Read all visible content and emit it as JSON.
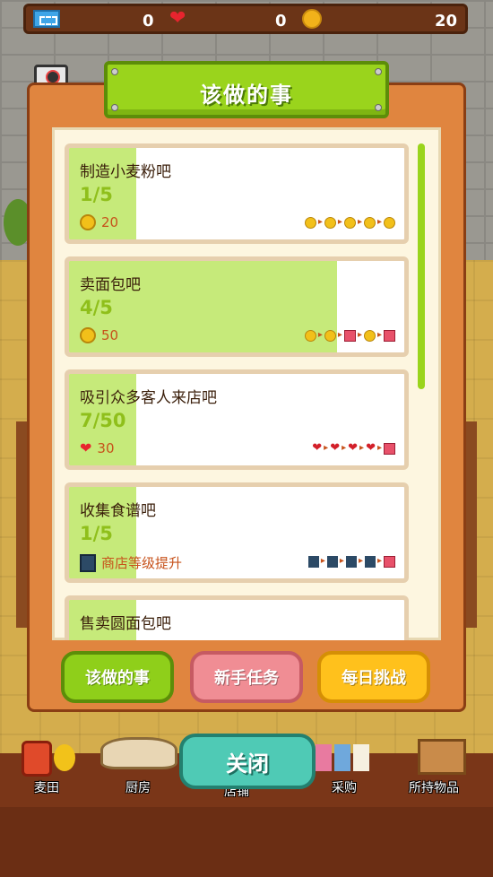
{
  "resources": {
    "tickets": "0",
    "hearts": "0",
    "coins": "20"
  },
  "camera": {
    "label": "照相"
  },
  "panel": {
    "title": "该做的事"
  },
  "tasks": [
    {
      "title": "制造小麦粉吧",
      "progress": "1/5",
      "reward_icon": "coin-icon",
      "reward": "20",
      "fill_fraction": 0.2,
      "steps": [
        "coin",
        "coin",
        "coin",
        "coin",
        "coin"
      ]
    },
    {
      "title": "卖面包吧",
      "progress": "4/5",
      "reward_icon": "coin-icon",
      "reward": "50",
      "fill_fraction": 0.8,
      "steps": [
        "coin",
        "coin",
        "gift",
        "coin",
        "gift"
      ]
    },
    {
      "title": "吸引众多客人来店吧",
      "progress": "7/50",
      "reward_icon": "heart-icon",
      "reward": "30",
      "fill_fraction": 0.14,
      "steps": [
        "heart",
        "heart",
        "heart",
        "heart",
        "gift"
      ]
    },
    {
      "title": "收集食谱吧",
      "progress": "1/5",
      "reward_icon": "book-icon",
      "reward": "商店等级提升",
      "fill_fraction": 0.2,
      "steps": [
        "book",
        "book",
        "book",
        "book",
        "gift"
      ]
    },
    {
      "title": "售卖圆面包吧",
      "progress": "",
      "reward_icon": "",
      "reward": "",
      "fill_fraction": 0.2,
      "steps": []
    }
  ],
  "tabs": {
    "todo": "该做的事",
    "newbie": "新手任务",
    "daily": "每日挑战"
  },
  "nav": {
    "wheat_field": "麦田",
    "kitchen": "厨房",
    "shop": "店铺",
    "purchase": "采购",
    "items": "所持物品"
  },
  "close_label": "关闭",
  "colors": {
    "accent_green": "#9ad41c",
    "progress_fill": "#c6ea7a",
    "reward_text": "#c7521b",
    "close_teal": "#4fcab5"
  }
}
